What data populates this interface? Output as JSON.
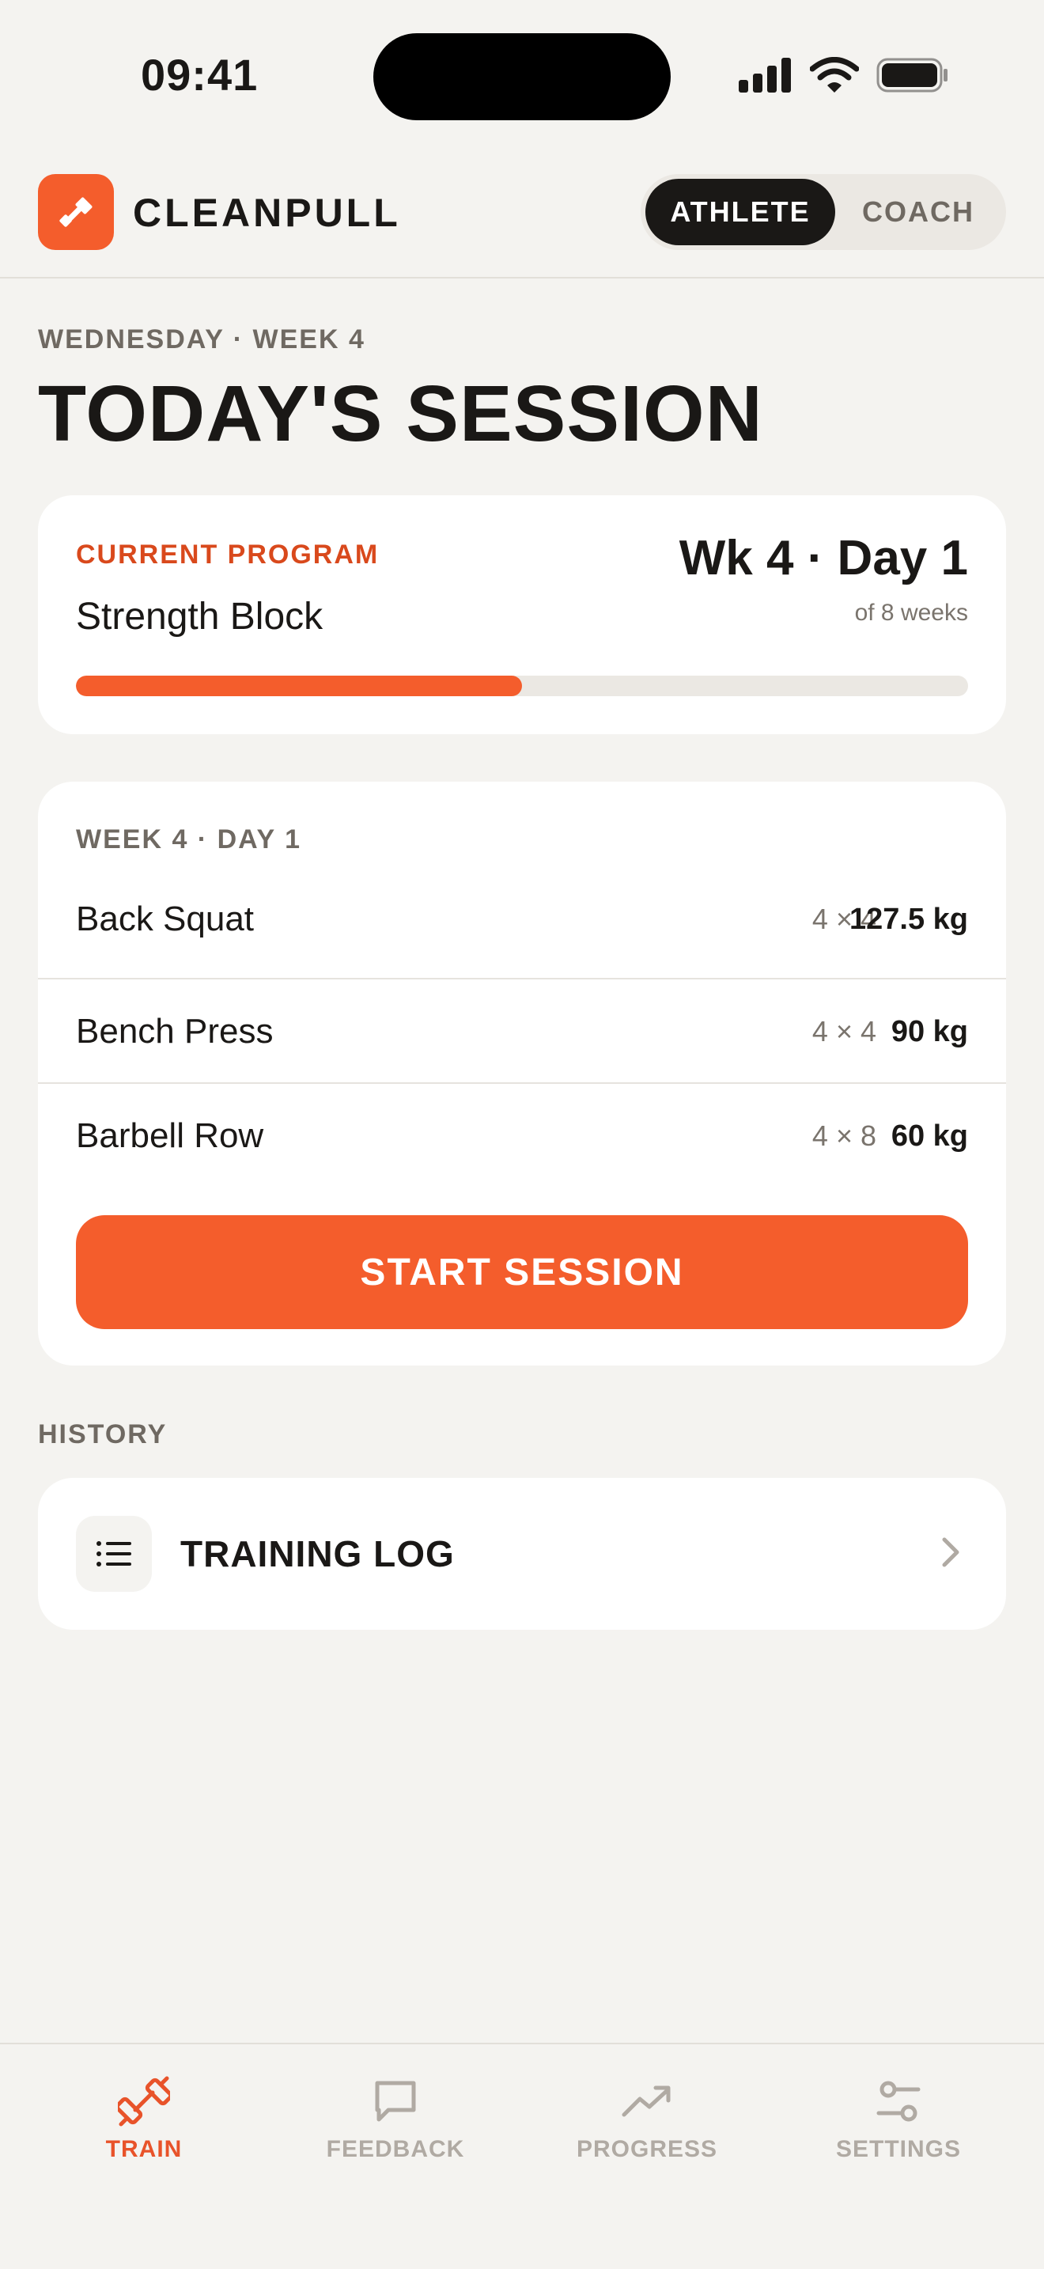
{
  "status_bar": {
    "time": "09:41"
  },
  "header": {
    "app_name": "CLEANPULL",
    "logo_icon": "hammer-icon",
    "roles": [
      {
        "label": "ATHLETE",
        "active": true
      },
      {
        "label": "COACH",
        "active": false
      }
    ]
  },
  "page": {
    "eyebrow": "WEDNESDAY · WEEK 4",
    "title": "TODAY'S SESSION"
  },
  "program": {
    "label": "CURRENT PROGRAM",
    "name": "Strength Block",
    "week_day": "Wk 4 · Day 1",
    "of_weeks": "of 8 weeks",
    "progress": 0.5
  },
  "session": {
    "label": "WEEK 4 · DAY 1",
    "exercises": [
      {
        "name": "Back Squat",
        "scheme": "4 × 4",
        "load": "127.5 kg"
      },
      {
        "name": "Bench Press",
        "scheme": "4 × 4",
        "load": "90 kg"
      },
      {
        "name": "Barbell Row",
        "scheme": "4 × 8",
        "load": "60 kg"
      }
    ],
    "start_label": "START SESSION"
  },
  "history": {
    "label": "HISTORY",
    "log_title": "TRAINING LOG",
    "log_icon": "list-icon"
  },
  "tabs": [
    {
      "label": "TRAIN",
      "icon": "dumbbell-icon",
      "active": true
    },
    {
      "label": "FEEDBACK",
      "icon": "chat-bubble-icon",
      "active": false
    },
    {
      "label": "PROGRESS",
      "icon": "trending-up-icon",
      "active": false
    },
    {
      "label": "SETTINGS",
      "icon": "sliders-icon",
      "active": false
    }
  ],
  "colors": {
    "accent": "#f45d2c",
    "accent_text": "#d9491c",
    "background": "#f4f3f0",
    "card": "#ffffff",
    "ink": "#1a1816",
    "muted": "#6f6962"
  }
}
